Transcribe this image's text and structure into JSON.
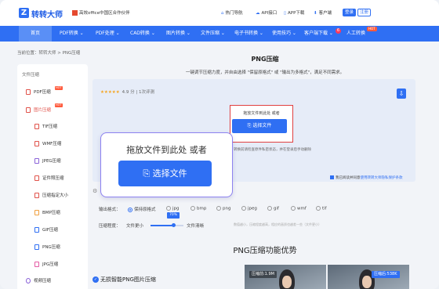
{
  "header": {
    "logo_icon": "Z",
    "logo_text": "转转大师",
    "partner_text": "高效office中国区合作伙伴",
    "links": [
      {
        "label": "热门导航",
        "icon": "home-icon"
      },
      {
        "label": "API接口",
        "icon": "cloud-icon"
      },
      {
        "label": "APP下载",
        "icon": "phone-icon"
      },
      {
        "label": "客户端",
        "icon": "download-icon"
      }
    ],
    "login_label": "登录",
    "register_label": "注册"
  },
  "nav": {
    "items": [
      "首页",
      "PDF转换",
      "PDF处理",
      "CAD转换",
      "图片转换",
      "文件压缩",
      "电子书转换",
      "使用技巧",
      "客户端下载",
      "人工转换"
    ],
    "hot_label": "HOT",
    "badge": "6"
  },
  "breadcrumb": "当前位置：转转大师 > PNG压缩",
  "sidebar": {
    "heading": "文件压缩",
    "items": [
      {
        "label": "PDF压缩",
        "hot": true
      },
      {
        "label": "图片压缩",
        "hot": true
      },
      {
        "label": "TIF压缩"
      },
      {
        "label": "WMF压缩"
      },
      {
        "label": "JPEG压缩"
      },
      {
        "label": "证件照压缩"
      },
      {
        "label": "压缩指定大小"
      },
      {
        "label": "BMP压缩"
      },
      {
        "label": "GIF压缩"
      },
      {
        "label": "PNG压缩"
      },
      {
        "label": "JPG压缩"
      },
      {
        "label": "视频压缩"
      }
    ]
  },
  "main": {
    "title": "PNG压缩",
    "subtitle": "一键调节压缩力度，并自由选择 \"保留原格式\" 或 \"输出为多格式\"，满足不同需求。",
    "rating_stars": "★★★★★",
    "rating_text": "4.9 分 | 1次评测",
    "drop_text": "拖放文件到此处 或者",
    "choose_label": "选择文件",
    "privacy_text": "转换前请检查原件私密状态，并在登录后手动删除",
    "agree_text": "我已阅读并同意",
    "agree_link": "使用转转大师隐私保护条款",
    "tooltip": {
      "text": "拖放文件到此处 或者",
      "button_label": "选择文件"
    }
  },
  "settings": {
    "format_label": "输出格式：",
    "formats": [
      {
        "label": "保持原格式",
        "selected": true
      },
      {
        "label": "jpg"
      },
      {
        "label": "bmp"
      },
      {
        "label": "png"
      },
      {
        "label": "jpeg"
      },
      {
        "label": "gif"
      },
      {
        "label": "wmf"
      },
      {
        "label": "tif"
      }
    ],
    "degree_label": "压缩程度：",
    "left_label": "文件更小",
    "right_label": "文件清晰",
    "slider_value": "70%",
    "slider_fraction": 0.7,
    "hint": "数值越小，压缩程度越高，相应的画质也越差一些（文件更小）"
  },
  "advantages": {
    "title": "PNG压缩功能优势",
    "feature": "无损智能PNG图片压缩",
    "before_label": "压缩前:1.9M",
    "after_label": "压缩后:538K"
  },
  "colors": {
    "brand": "#2f6ff3",
    "accent_red": "#e04040",
    "tooltip_border": "#8d82f0"
  }
}
